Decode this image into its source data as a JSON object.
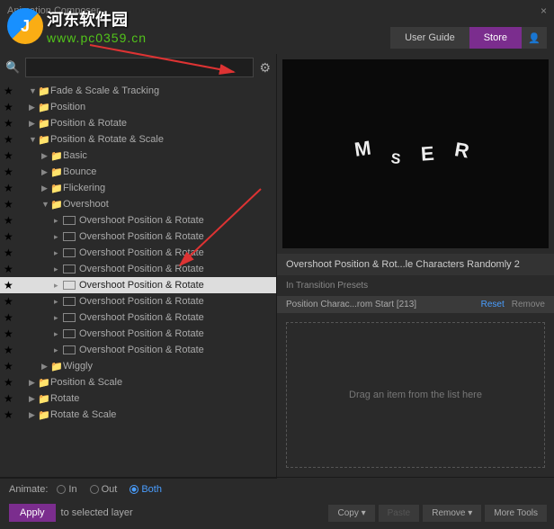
{
  "watermark": {
    "cn": "河东软件园",
    "url": "www.pc0359.cn"
  },
  "header": {
    "title": "Animation Composer"
  },
  "topbar": {
    "user_guide": "User Guide",
    "store": "Store"
  },
  "search": {
    "placeholder": ""
  },
  "tree": {
    "items": [
      {
        "depth": 1,
        "type": "folder",
        "open": true,
        "label": "Fade & Scale & Tracking"
      },
      {
        "depth": 1,
        "type": "folder",
        "open": false,
        "label": "Position"
      },
      {
        "depth": 1,
        "type": "folder",
        "open": false,
        "label": "Position & Rotate"
      },
      {
        "depth": 1,
        "type": "folder",
        "open": true,
        "label": "Position & Rotate & Scale"
      },
      {
        "depth": 2,
        "type": "folder",
        "open": false,
        "label": "Basic"
      },
      {
        "depth": 2,
        "type": "folder",
        "open": false,
        "label": "Bounce"
      },
      {
        "depth": 2,
        "type": "folder",
        "open": false,
        "label": "Flickering"
      },
      {
        "depth": 2,
        "type": "folder",
        "open": true,
        "label": "Overshoot"
      },
      {
        "depth": 3,
        "type": "item",
        "label": "Overshoot Position & Rotate"
      },
      {
        "depth": 3,
        "type": "item",
        "label": "Overshoot Position & Rotate"
      },
      {
        "depth": 3,
        "type": "item",
        "label": "Overshoot Position & Rotate"
      },
      {
        "depth": 3,
        "type": "item",
        "label": "Overshoot Position & Rotate"
      },
      {
        "depth": 3,
        "type": "item",
        "label": "Overshoot Position & Rotate",
        "selected": true
      },
      {
        "depth": 3,
        "type": "item",
        "label": "Overshoot Position & Rotate"
      },
      {
        "depth": 3,
        "type": "item",
        "label": "Overshoot Position & Rotate"
      },
      {
        "depth": 3,
        "type": "item",
        "label": "Overshoot Position & Rotate"
      },
      {
        "depth": 3,
        "type": "item",
        "label": "Overshoot Position & Rotate"
      },
      {
        "depth": 2,
        "type": "folder",
        "open": false,
        "label": "Wiggly"
      },
      {
        "depth": 1,
        "type": "folder",
        "open": false,
        "label": "Position & Scale"
      },
      {
        "depth": 1,
        "type": "folder",
        "open": false,
        "label": "Rotate"
      },
      {
        "depth": 1,
        "type": "folder",
        "open": false,
        "label": "Rotate & Scale"
      }
    ]
  },
  "preview": {
    "letters": [
      "M",
      "S",
      "E",
      "R"
    ]
  },
  "info": {
    "title": "Overshoot Position & Rot...le Characters Randomly 2",
    "section": "In Transition Presets",
    "preset": "Position Charac...rom Start [213]",
    "reset": "Reset",
    "remove": "Remove"
  },
  "dropzone": {
    "text": "Drag an item from the list here"
  },
  "animate": {
    "label": "Animate:",
    "options": [
      {
        "label": "In",
        "checked": false
      },
      {
        "label": "Out",
        "checked": false
      },
      {
        "label": "Both",
        "checked": true
      }
    ]
  },
  "apply": {
    "button": "Apply",
    "suffix": "to selected layer"
  },
  "tools": {
    "copy": "Copy ▾",
    "paste": "Paste",
    "remove": "Remove ▾",
    "more": "More Tools"
  }
}
